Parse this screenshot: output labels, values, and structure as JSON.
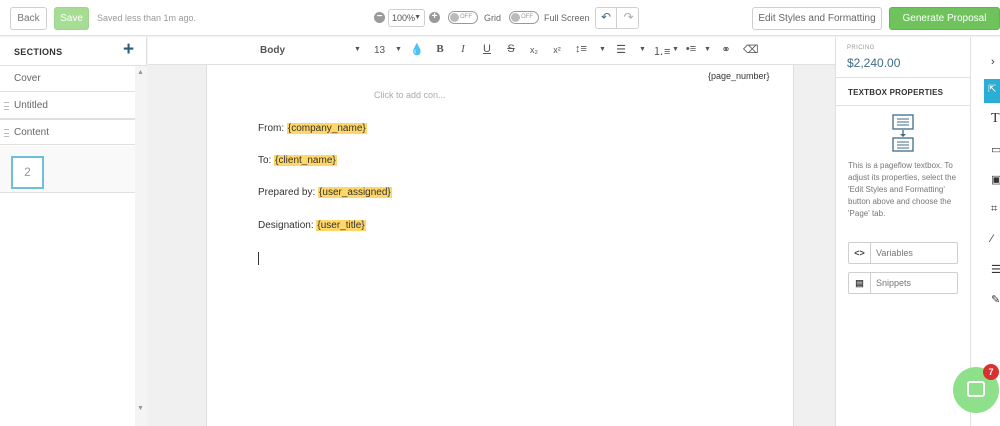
{
  "topbar": {
    "back_label": "Back",
    "save_label": "Save",
    "saved_status": "Saved less than 1m ago.",
    "zoom_value": "100%",
    "grid_label": "Grid",
    "grid_state": "OFF",
    "fullscreen_label": "Full Screen",
    "fullscreen_state": "OFF",
    "edit_styles_label": "Edit Styles and Formatting",
    "generate_label": "Generate Proposal"
  },
  "sidebar": {
    "title": "SECTIONS",
    "add_icon": "plus-icon",
    "items": [
      {
        "label": "Cover"
      },
      {
        "label": "Untitled"
      },
      {
        "label": "Content"
      }
    ],
    "page_thumb": "2"
  },
  "format_toolbar": {
    "style": "Body",
    "font_size": "13",
    "icons": [
      "color-drop-icon",
      "bold-icon",
      "italic-icon",
      "underline-icon",
      "strikethrough-icon",
      "subscript-icon",
      "superscript-icon",
      "line-height-icon",
      "align-icon",
      "ordered-list-icon",
      "bullet-list-icon",
      "link-icon",
      "clear-format-icon"
    ]
  },
  "document": {
    "page_number": "{page_number}",
    "add_content_placeholder": "Click to add con...",
    "lines": [
      {
        "label": "From: ",
        "var": "{company_name}"
      },
      {
        "label": "To: ",
        "var": "{client_name}"
      },
      {
        "label": "Prepared by: ",
        "var": "{user_assigned}"
      },
      {
        "label": "Designation: ",
        "var": "{user_title}"
      }
    ]
  },
  "right_panel": {
    "pricing_label": "PRICING",
    "pricing_value": "$2,240.00",
    "textbox_title": "TEXTBOX PROPERTIES",
    "textbox_desc": "This is a pageflow textbox. To adjust its properties, select the 'Edit Styles and Formatting' button above and choose the 'Page' tab.",
    "variables_label": "Variables",
    "snippets_label": "Snippets"
  },
  "chat": {
    "badge_count": "7"
  },
  "colors": {
    "accent": "#2baed6",
    "brand_green": "#6fc35d",
    "variable_highlight": "#ffd766",
    "pricing_blue": "#3d6c86"
  }
}
